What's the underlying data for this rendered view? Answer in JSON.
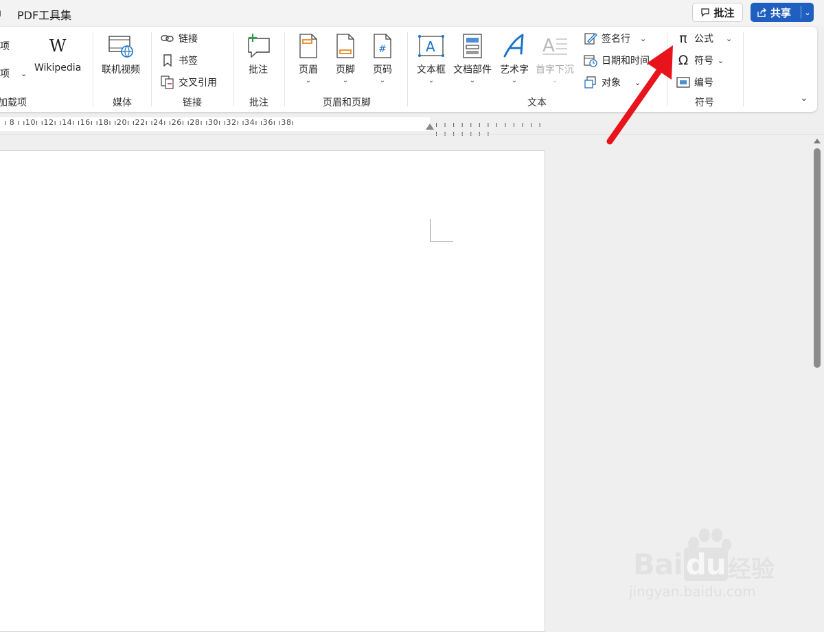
{
  "titlebar": {
    "menu_fragment": "ı",
    "tab_label": "PDF工具集",
    "comment_button": "批注",
    "share_button": "共享"
  },
  "ribbon": {
    "addins": {
      "item1": "项",
      "item2": "项",
      "wikipedia": "Wikipedia",
      "group": "加载项"
    },
    "media": {
      "online_video": "联机视频",
      "group": "媒体"
    },
    "links": {
      "link": "链接",
      "bookmark": "书签",
      "cross_ref": "交叉引用",
      "group": "链接"
    },
    "comments": {
      "comment": "批注",
      "group": "批注"
    },
    "header_footer": {
      "header": "页眉",
      "footer": "页脚",
      "page_number": "页码",
      "group": "页眉和页脚"
    },
    "text": {
      "textbox": "文本框",
      "quick_parts": "文档部件",
      "wordart": "艺术字",
      "dropcap": "首字下沉",
      "signature_line": "签名行",
      "date_time": "日期和时间",
      "object": "对象",
      "group": "文本"
    },
    "symbols": {
      "equation": "公式",
      "symbol": "符号",
      "number": "编号",
      "group": "符号"
    }
  },
  "ruler": {
    "numbers": "ı 8 ı  ı10ı  ı12ı  ı14ı  ı16ı  ı18ı  ı20ı  ı22ı  ı24ı  ı26ı  ı28ı  ı30ı  ı32ı  ı34ı  ı36ı  ı38ı",
    "ticks": "ı ı ı ı ı ı ı ı ı ı ı ı ı ı ı ı ı ı ı ı"
  },
  "watermark": {
    "brand": "Bai",
    "brand_suffix": "du",
    "cn": "经验",
    "url": "jingyan.baidu.com"
  },
  "colors": {
    "share_blue": "#1f5fbf",
    "arrow_red": "#e8141b"
  }
}
